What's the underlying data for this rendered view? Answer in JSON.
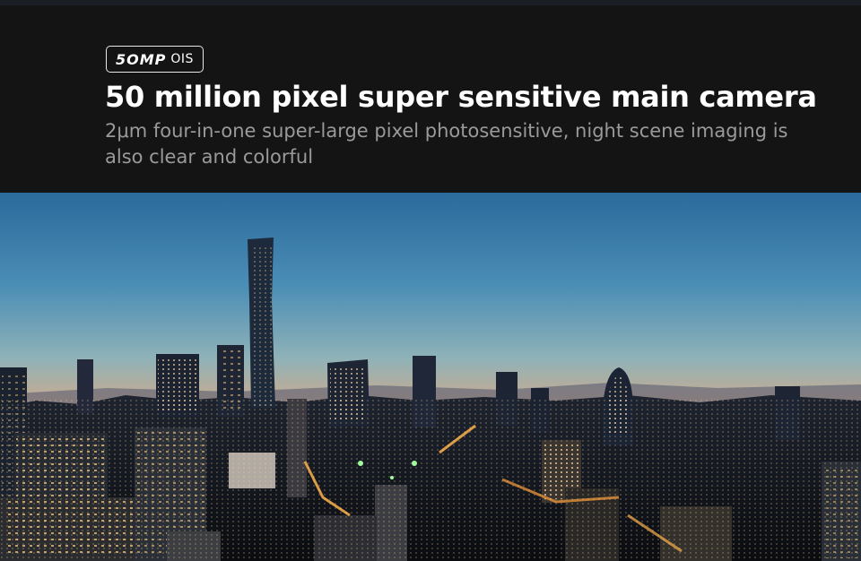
{
  "badge": {
    "mp_label": "5OMP",
    "ois_label": "OIS"
  },
  "title": "50 million pixel super sensitive main camera",
  "subtitle": "2μm four-in-one super-large pixel photosensitive, night scene imaging is also clear and colorful",
  "photo": {
    "subject": "city-skyline-at-dusk"
  },
  "colors": {
    "header_bg": "#141414",
    "title": "#ffffff",
    "subtitle": "#9a9a9a",
    "sky_top": "#2f6e9f",
    "sky_horizon": "#e98a5e"
  }
}
